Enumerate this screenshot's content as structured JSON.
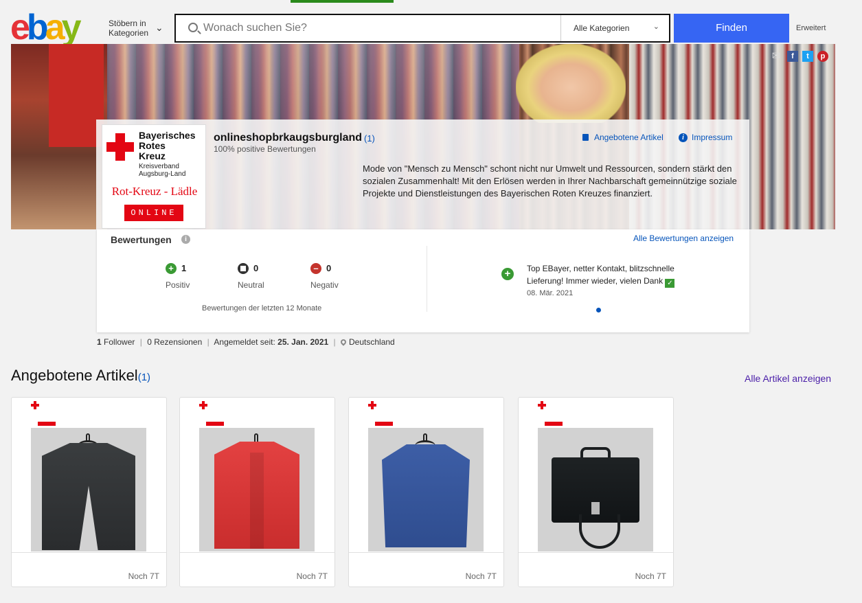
{
  "header": {
    "logo": {
      "e": "e",
      "b": "b",
      "a": "a",
      "y": "y"
    },
    "browse_line1": "Stöbern in",
    "browse_line2": "Kategorien",
    "search_placeholder": "Wonach suchen Sie?",
    "category": "Alle Kategorien",
    "find_label": "Finden",
    "advanced_label": "Erweitert"
  },
  "store": {
    "logo": {
      "line1": "Bayerisches",
      "line2": "Rotes",
      "line3": "Kreuz",
      "sub1": "Kreisverband",
      "sub2": "Augsburg-Land",
      "laedle": "Rot-Kreuz - Lädle",
      "online": "ONLINE"
    },
    "name": "onlineshopbrkaugsburgland",
    "count": "(1)",
    "positive": "100% positive Bewertungen",
    "link_items": "Angebotene Artikel",
    "link_imprint": "Impressum",
    "description": "Mode von \"Mensch zu Mensch\" schont nicht nur Umwelt und Ressourcen, sondern stärkt den sozialen Zusammenhalt! Mit den Erlösen werden in Ihrer Nachbarschaft gemeinnützige soziale Projekte und Dienstleistungen des Bayerischen Roten Kreuzes finanziert."
  },
  "feedback": {
    "title": "Bewertungen",
    "all_link": "Alle Bewertungen anzeigen",
    "positive": {
      "count": "1",
      "label": "Positiv"
    },
    "neutral": {
      "count": "0",
      "label": "Neutral"
    },
    "negative": {
      "count": "0",
      "label": "Negativ"
    },
    "period": "Bewertungen der letzten 12 Monate",
    "comment": "Top EBayer, netter Kontakt, blitzschnelle Lieferung! Immer wieder, vielen Dank",
    "comment_date": "08. Mär. 2021"
  },
  "meta": {
    "followers_count": "1",
    "followers_label": "Follower",
    "reviews": "0 Rezensionen",
    "registered_label": "Angemeldet seit:",
    "registered_date": "25. Jan. 2021",
    "location": "Deutschland"
  },
  "items_section": {
    "title": "Angebotene Artikel",
    "count": "(1)",
    "all_link": "Alle Artikel anzeigen"
  },
  "cards": [
    {
      "time_left": "Noch 7T"
    },
    {
      "time_left": "Noch 7T"
    },
    {
      "time_left": "Noch 7T"
    },
    {
      "time_left": "Noch 7T"
    }
  ],
  "colors": {
    "brand_red": "#e53238",
    "brand_blue": "#0064d2",
    "brand_yellow": "#f5af02",
    "brand_green": "#86b817",
    "find_button": "#3665f3",
    "link_blue": "#0654ba",
    "brk_red": "#e30613"
  }
}
